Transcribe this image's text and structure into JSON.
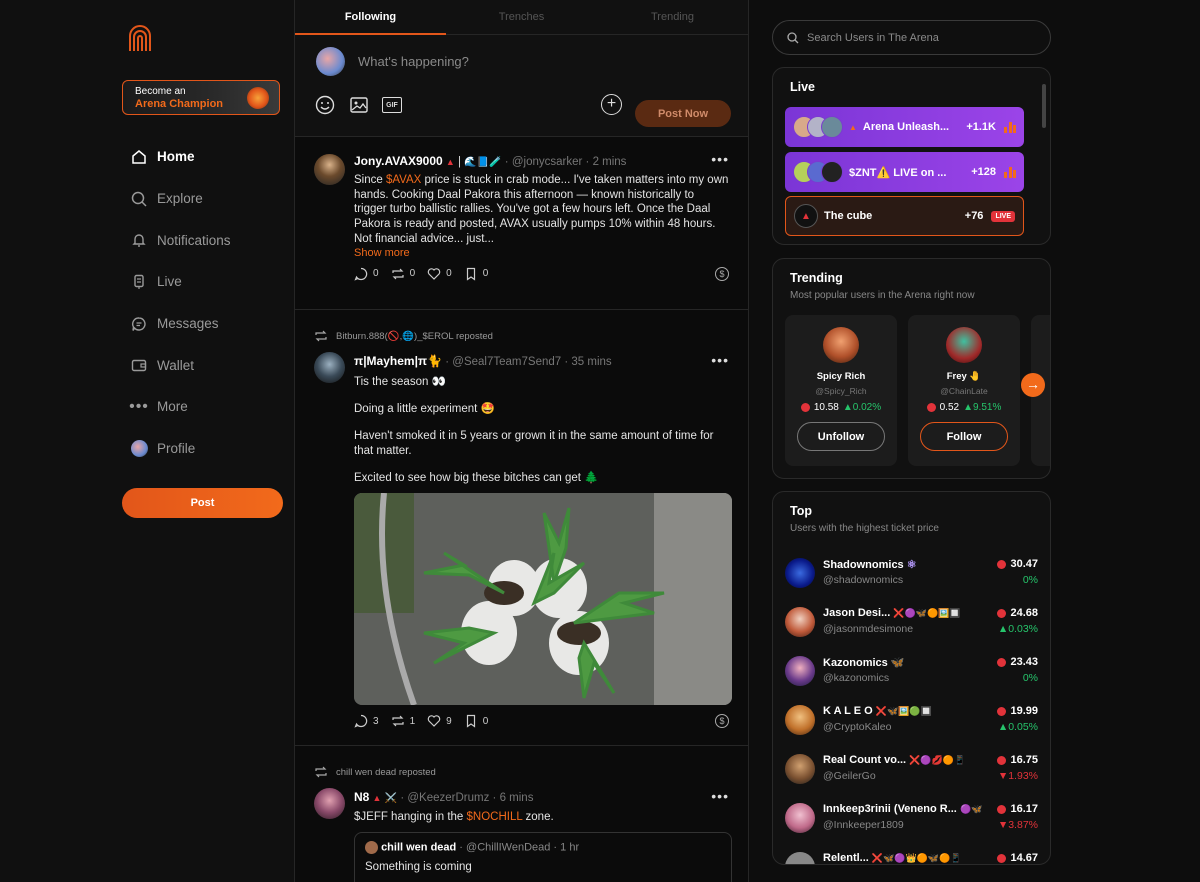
{
  "sidebar": {
    "promo": {
      "line1": "Become an",
      "line2": "Arena Champion"
    },
    "nav": [
      {
        "label": "Home",
        "icon": "home-icon"
      },
      {
        "label": "Explore",
        "icon": "search-icon"
      },
      {
        "label": "Notifications",
        "icon": "bell-icon"
      },
      {
        "label": "Live",
        "icon": "mic-icon"
      },
      {
        "label": "Messages",
        "icon": "chat-icon"
      },
      {
        "label": "Wallet",
        "icon": "wallet-icon"
      },
      {
        "label": "More",
        "icon": "more-icon"
      },
      {
        "label": "Profile",
        "icon": "avatar-icon"
      }
    ],
    "post_label": "Post"
  },
  "feed": {
    "tabs": [
      "Following",
      "Trenches",
      "Trending"
    ],
    "compose": {
      "placeholder": "What's happening?",
      "gif": "GIF",
      "post_now": "Post Now"
    },
    "posts": [
      {
        "name": "Jony.AVAX9000",
        "handle": "@jonycsarker",
        "time": "2 mins",
        "text_pre": "Since ",
        "text_hl": "$AVAX",
        "text_post": " price is stuck in crab mode... I've taken matters into my own hands. Cooking Daal Pakora this afternoon — known historically to trigger turbo ballistic rallies. You've got a few hours left. Once the Daal Pakora is ready and posted, AVAX usually pumps 10% within 48 hours. Not financial advice... just...",
        "show_more": "Show more",
        "replies": "0",
        "reposts": "0",
        "likes": "0",
        "bookmarks": "0"
      },
      {
        "reposted_by": "Bitburn.888(🚫,🌐)_$EROL reposted",
        "name": "π|Mayhem|π🐈",
        "handle": "@Seal7Team7Send7",
        "time": "35 mins",
        "paragraphs": [
          "Tis the season 👀",
          "Doing a little experiment 🤩",
          "Haven't smoked it in 5 years or grown it in the same amount of time for that matter.",
          "Excited to see how big these bitches can get 🌲"
        ],
        "replies": "3",
        "reposts": "1",
        "likes": "9",
        "bookmarks": "0"
      },
      {
        "reposted_by": "chill wen dead reposted",
        "name": "N8",
        "handle": "@KeezerDrumz",
        "time": "6 mins",
        "text_pre": "$JEFF hanging in the ",
        "text_hl": "$NOCHILL",
        "text_post": " zone.",
        "quote": {
          "name": "chill wen dead",
          "handle": "@ChillIWenDead",
          "time": "1 hr",
          "text": "Something is coming"
        }
      }
    ]
  },
  "right": {
    "search_placeholder": "Search Users in The Arena",
    "live": {
      "title": "Live",
      "rows": [
        {
          "name": "Arena Unleash...",
          "count": "+1.1K"
        },
        {
          "name": "$ZNT⚠️ LIVE on ...",
          "count": "+128"
        },
        {
          "name": "The cube",
          "count": "+76",
          "badge": "LIVE"
        }
      ]
    },
    "trending": {
      "title": "Trending",
      "subtitle": "Most popular users in the Arena right now",
      "users": [
        {
          "name": "Spicy Rich",
          "handle": "@Spicy_Rich",
          "price": "10.58",
          "change": "0.02%",
          "action": "Unfollow"
        },
        {
          "name": "Frey 🤚",
          "handle": "@ChainLate",
          "price": "0.52",
          "change": "9.51%",
          "action": "Follow"
        }
      ]
    },
    "top": {
      "title": "Top",
      "subtitle": "Users with the highest ticket price",
      "users": [
        {
          "name": "Shadownomics",
          "handle": "@shadownomics",
          "price": "30.47",
          "change": "0%",
          "dir": "flat"
        },
        {
          "name": "Jason Desi...",
          "handle": "@jasonmdesimone",
          "price": "24.68",
          "change": "0.03%",
          "dir": "up"
        },
        {
          "name": "Kazonomics",
          "handle": "@kazonomics",
          "price": "23.43",
          "change": "0%",
          "dir": "flat"
        },
        {
          "name": "K A L E O",
          "handle": "@CryptoKaleo",
          "price": "19.99",
          "change": "0.05%",
          "dir": "up"
        },
        {
          "name": "Real Count vo...",
          "handle": "@GeilerGo",
          "price": "16.75",
          "change": "1.93%",
          "dir": "down"
        },
        {
          "name": "Innkeep3rinii (Veneno R...",
          "handle": "@Innkeeper1809",
          "price": "16.17",
          "change": "3.87%",
          "dir": "down"
        },
        {
          "name": "Relentl...",
          "handle": "",
          "price": "14.67",
          "change": "",
          "dir": "flat"
        }
      ]
    }
  },
  "colors": {
    "accent": "#f26a1b",
    "live_purple": "#7b35d6",
    "up": "#26c46b",
    "down": "#e2333a"
  }
}
